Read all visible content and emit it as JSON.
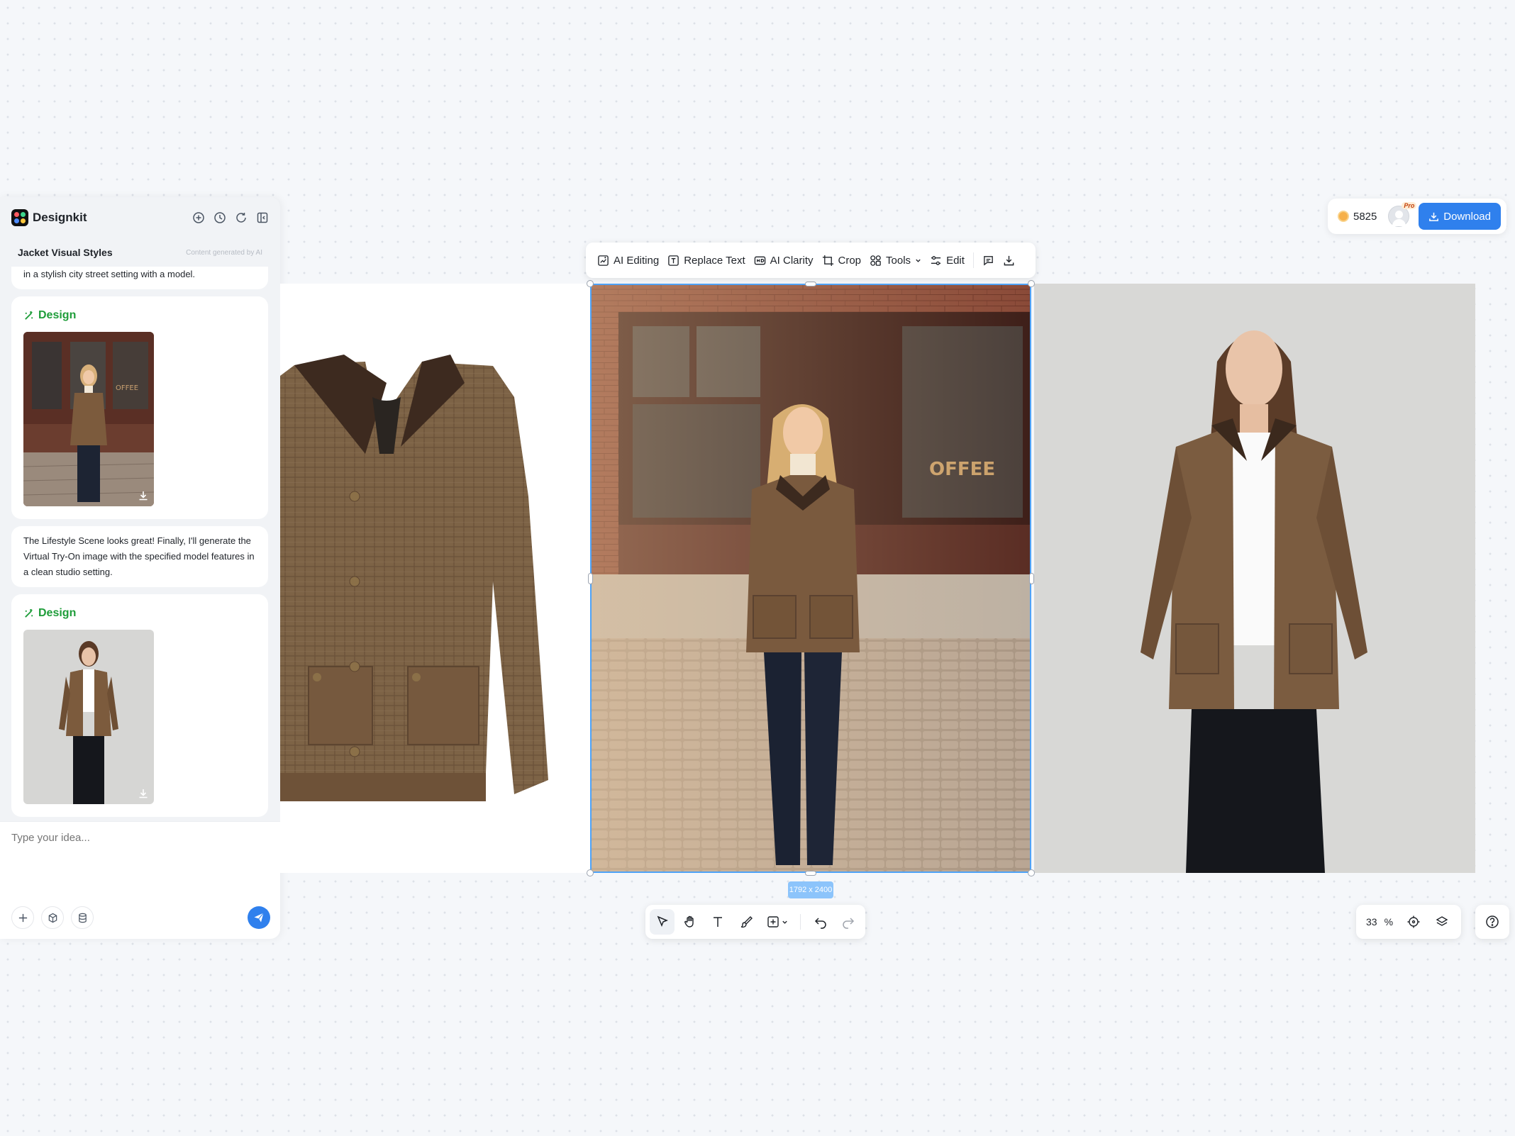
{
  "app": {
    "brand": "Designkit",
    "project_title": "Jacket Visual Styles",
    "ai_note": "Content generated by AI"
  },
  "header_icons": [
    "new-chat-icon",
    "history-icon",
    "refresh-icon",
    "collapse-panel-icon"
  ],
  "chat": {
    "messages": [
      {
        "type": "text",
        "text": "in a stylish city street setting with a model."
      },
      {
        "type": "design",
        "label": "Design",
        "image": "lifestyle-scene-thumbnail"
      },
      {
        "type": "text",
        "text": "The Lifestyle Scene looks great! Finally, I'll generate the Virtual Try-On image with the specified model features in a clean studio setting."
      },
      {
        "type": "design",
        "label": "Design",
        "image": "virtual-try-on-thumbnail"
      }
    ],
    "input_placeholder": "Type your idea..."
  },
  "image_toolbar": {
    "ai_editing": "AI Editing",
    "replace_text": "Replace Text",
    "ai_clarity": "AI Clarity",
    "crop": "Crop",
    "tools": "Tools",
    "edit": "Edit"
  },
  "canvas": {
    "selection_size": "1792 x 2400",
    "images": [
      "product-jacket-image",
      "lifestyle-street-image",
      "studio-try-on-image"
    ]
  },
  "account": {
    "credits": "5825",
    "badge": "Pro",
    "download_label": "Download"
  },
  "zoom": {
    "value": "33",
    "unit": "%"
  },
  "colors": {
    "accent": "#2f80ed",
    "design_green": "#1f9d3a",
    "selection": "#4fa3f7"
  }
}
